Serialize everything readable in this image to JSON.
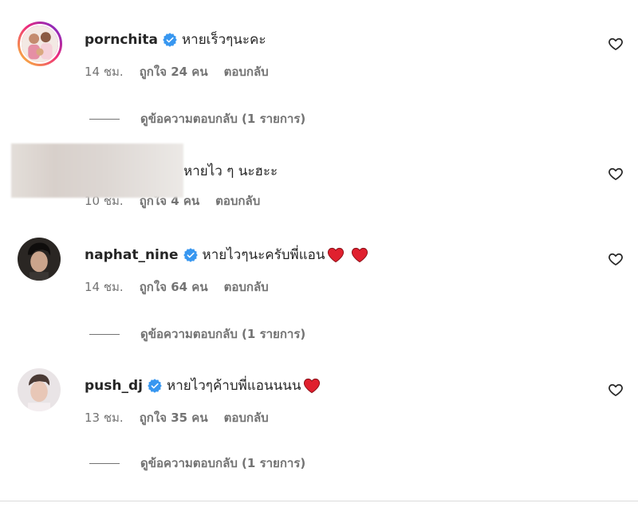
{
  "comments": [
    {
      "username": "pornchita",
      "verified": true,
      "text": "หายเร็วๆนะคะ",
      "time": "14 ชม.",
      "likes": "ถูกใจ 24 คน",
      "reply_label": "ตอบกลับ",
      "view_replies": "ดูข้อความตอบกลับ (1 รายการ)",
      "hearts": 0
    },
    {
      "username": "",
      "verified": false,
      "text": "หายไว ๆ นะฮะะ",
      "time": "10 ชม.",
      "likes": "ถูกใจ 4 คน",
      "reply_label": "ตอบกลับ",
      "hearts": 0
    },
    {
      "username": "naphat_nine",
      "verified": true,
      "text": "หายไวๆนะครับพี่แอน",
      "time": "14 ชม.",
      "likes": "ถูกใจ 64 คน",
      "reply_label": "ตอบกลับ",
      "view_replies": "ดูข้อความตอบกลับ (1 รายการ)",
      "hearts": 2
    },
    {
      "username": "push_dj",
      "verified": true,
      "text": "หายไวๆค้าบพี่แอนนนน",
      "time": "13 ชม.",
      "likes": "ถูกใจ 35 คน",
      "reply_label": "ตอบกลับ",
      "view_replies": "ดูข้อความตอบกลับ (1 รายการ)",
      "hearts": 1
    }
  ],
  "icons": {
    "like": "heart-outline-icon",
    "verified": "verified-badge-icon",
    "emoji": "red-heart-emoji"
  },
  "colors": {
    "verified_blue": "#3897f0",
    "muted_text": "#737373",
    "emoji_red": "#e0202e"
  }
}
